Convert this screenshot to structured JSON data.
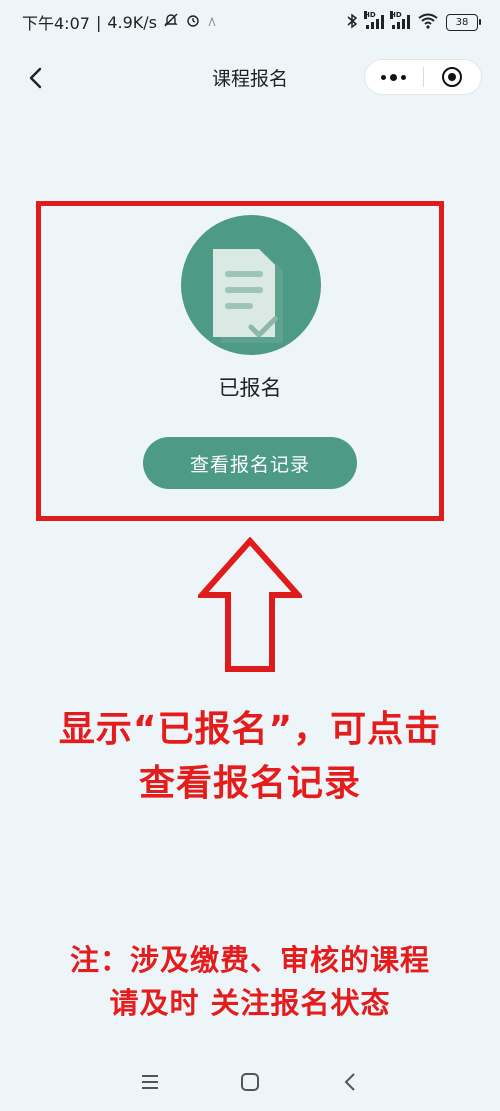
{
  "status_bar": {
    "time": "下午4:07",
    "speed": "4.9K/s",
    "signal_label_1": "HD",
    "signal_label_2": "HD",
    "battery": "38"
  },
  "nav": {
    "title": "课程报名"
  },
  "card": {
    "status_text": "已报名",
    "button_label": "查看报名记录"
  },
  "annotations": {
    "line1": "显示“已报名”，可点击",
    "line2": "查看报名记录",
    "note1": "注：涉及缴费、审核的课程",
    "note2": "请及时 关注报名状态"
  },
  "colors": {
    "accent": "#4d9a86",
    "highlight": "#e01b1b",
    "background": "#eef5f9"
  }
}
